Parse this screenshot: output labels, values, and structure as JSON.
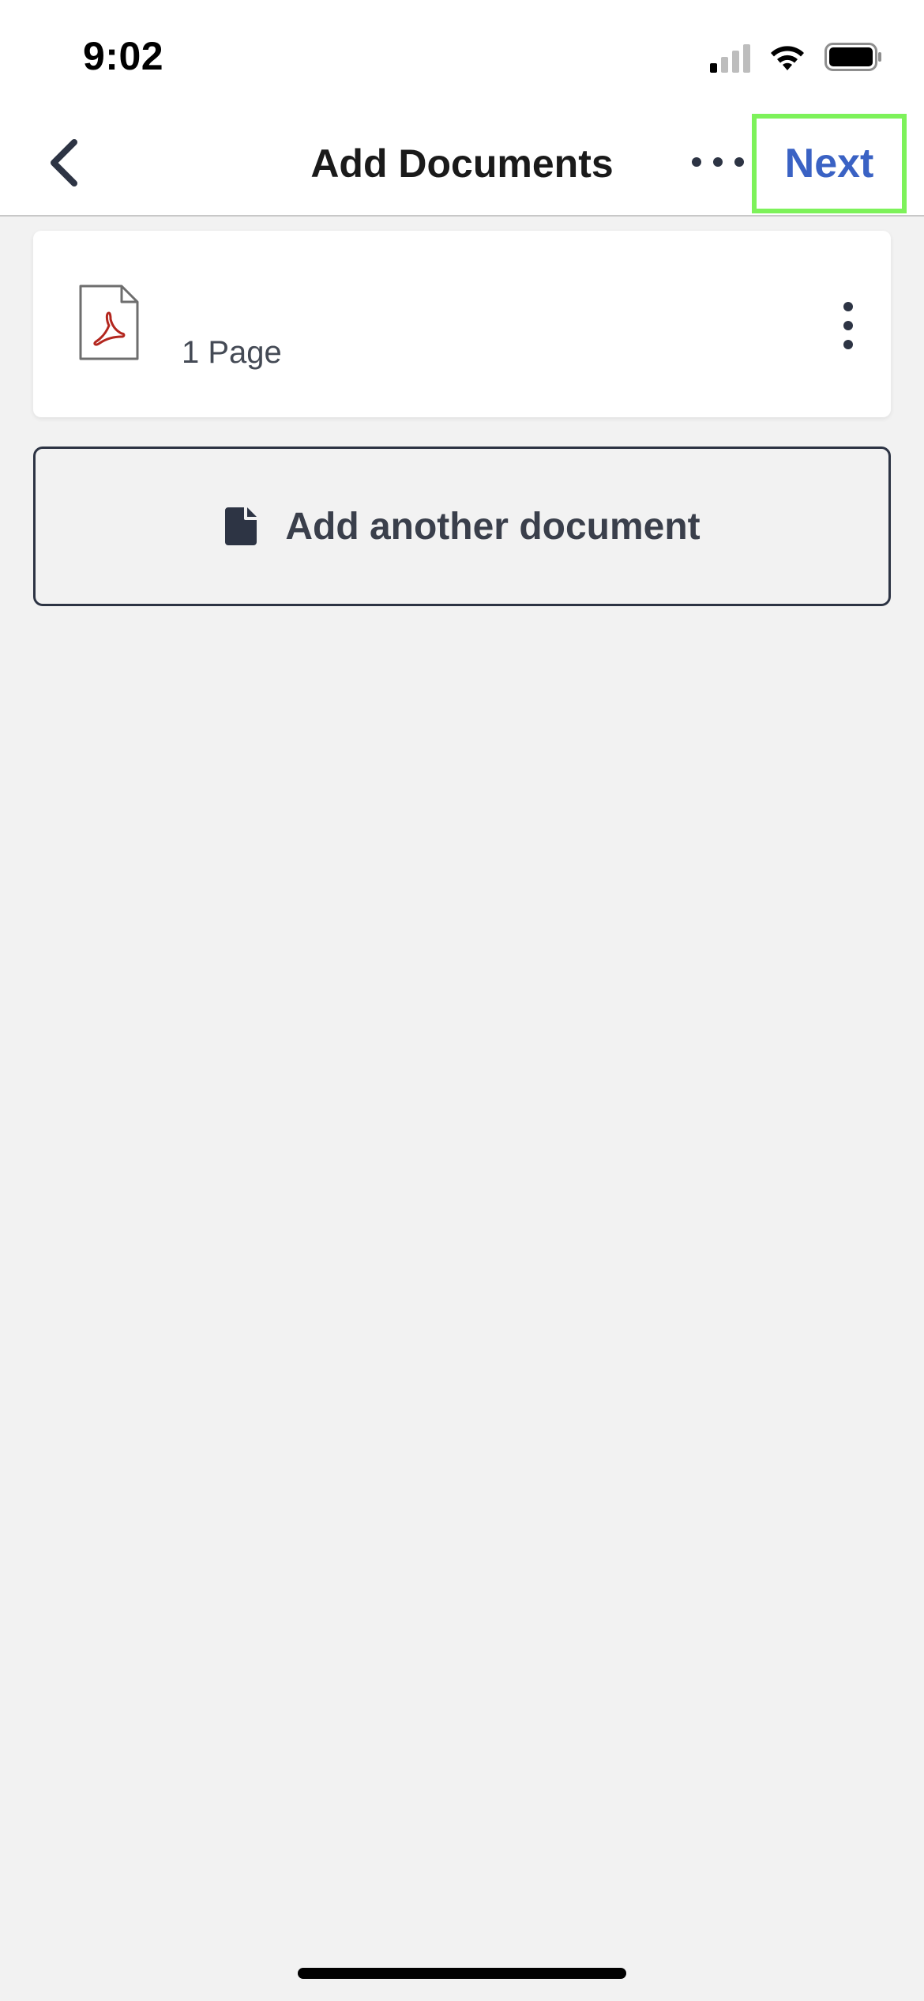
{
  "status_bar": {
    "time": "9:02",
    "icons": [
      "cellular-signal-icon",
      "wifi-icon",
      "battery-icon"
    ]
  },
  "nav": {
    "back_icon": "chevron-left-icon",
    "title": "Add Documents",
    "more_icon": "ellipsis-horizontal-icon",
    "next_label": "Next",
    "next_color": "#3a62c4",
    "highlight_color": "#7df25a"
  },
  "documents": [
    {
      "file_icon": "pdf-file-icon",
      "name": "",
      "pages": "1 Page",
      "menu_icon": "ellipsis-vertical-icon"
    }
  ],
  "add_document": {
    "icon": "document-icon",
    "label": "Add another document"
  },
  "colors": {
    "background": "#f2f2f2",
    "surface": "#ffffff",
    "text_dark": "#2d3444",
    "pdf_red": "#b3261e"
  }
}
